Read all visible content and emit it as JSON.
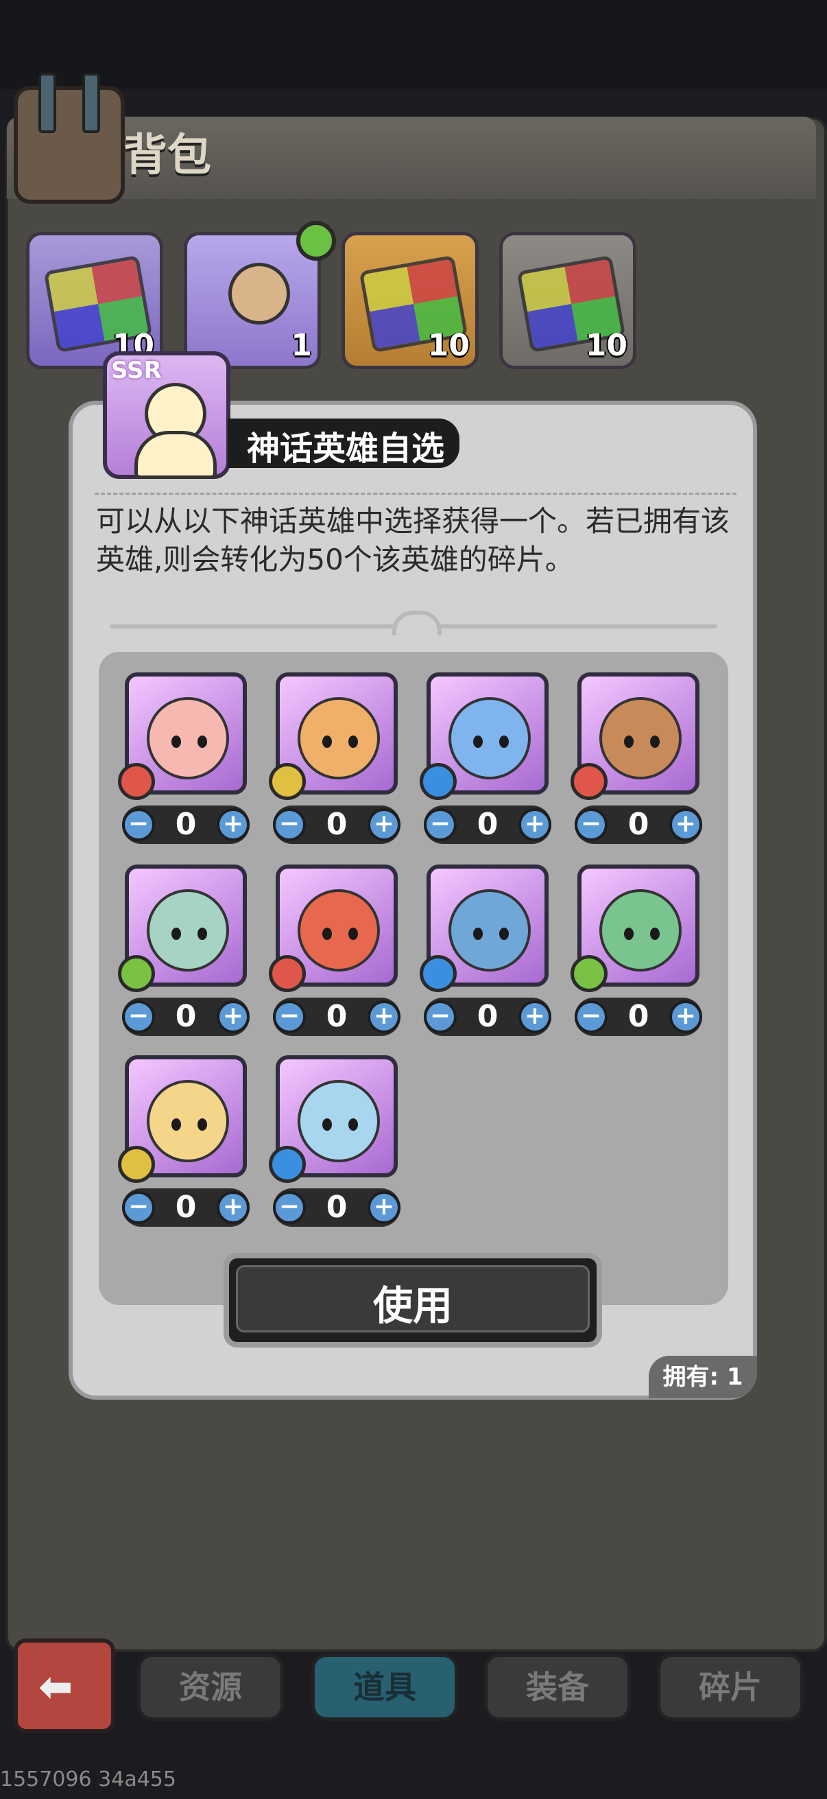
{
  "backpack": {
    "title": "背包",
    "top_items": [
      {
        "count": "10"
      },
      {
        "count": "1"
      },
      {
        "count": "10"
      },
      {
        "count": "10"
      }
    ]
  },
  "modal": {
    "title": "神话英雄自选",
    "ssr_tag": "SSR",
    "description": "可以从以下神话英雄中选择获得一个。若已拥有该英雄,则会转化为50个该英雄的碎片。",
    "heroes": [
      {
        "element": "fire",
        "value": "0",
        "minus": "−",
        "plus": "+"
      },
      {
        "element": "earth",
        "value": "0",
        "minus": "−",
        "plus": "+"
      },
      {
        "element": "water",
        "value": "0",
        "minus": "−",
        "plus": "+"
      },
      {
        "element": "fire",
        "value": "0",
        "minus": "−",
        "plus": "+"
      },
      {
        "element": "wind",
        "value": "0",
        "minus": "−",
        "plus": "+"
      },
      {
        "element": "fire",
        "value": "0",
        "minus": "−",
        "plus": "+"
      },
      {
        "element": "water",
        "value": "0",
        "minus": "−",
        "plus": "+"
      },
      {
        "element": "wind",
        "value": "0",
        "minus": "−",
        "plus": "+"
      },
      {
        "element": "earth",
        "value": "0",
        "minus": "−",
        "plus": "+"
      },
      {
        "element": "water",
        "value": "0",
        "minus": "−",
        "plus": "+"
      }
    ],
    "use_label": "使用",
    "owned_label": "拥有: 1"
  },
  "tabs": [
    {
      "label": "资源",
      "active": false
    },
    {
      "label": "道具",
      "active": true
    },
    {
      "label": "装备",
      "active": false
    },
    {
      "label": "碎片",
      "active": false
    }
  ],
  "back_icon": "back-arrow-icon",
  "footer_id": "1557096 34a455"
}
